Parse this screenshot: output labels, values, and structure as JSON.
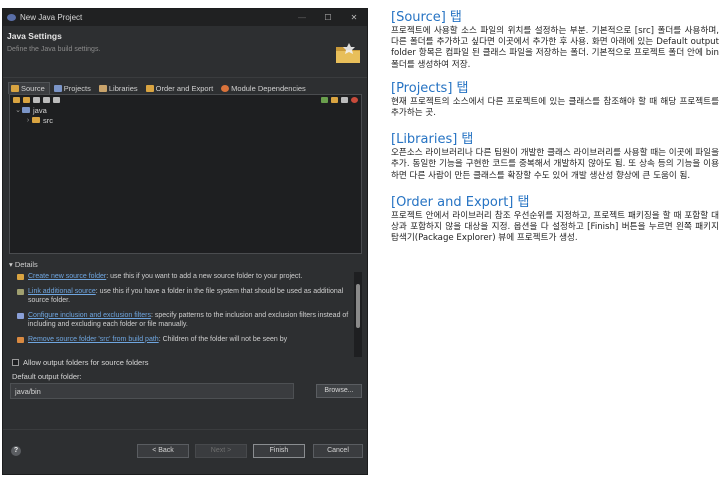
{
  "window": {
    "title": "New Java Project",
    "controls": [
      "—",
      "☐",
      "✕"
    ]
  },
  "banner": {
    "heading": "Java Settings",
    "subtitle": "Define the Java build settings."
  },
  "tabs": [
    {
      "label": "Source",
      "active": true,
      "icon": "source-folder-icon",
      "color": "#d9a441"
    },
    {
      "label": "Projects",
      "active": false,
      "icon": "projects-icon",
      "color": "#7b95c8"
    },
    {
      "label": "Libraries",
      "active": false,
      "icon": "libraries-icon",
      "color": "#c9a36b"
    },
    {
      "label": "Order and Export",
      "active": false,
      "icon": "order-export-icon",
      "color": "#d9a441"
    },
    {
      "label": "Module Dependencies",
      "active": false,
      "icon": "module-dependencies-icon",
      "color": "#d9733b"
    }
  ],
  "tree": {
    "rows": [
      {
        "expander": "⌄",
        "icon": "java-project-icon",
        "label": "java",
        "depth": 0
      },
      {
        "expander": "›",
        "icon": "src-folder-icon",
        "label": "src",
        "depth": 1
      }
    ]
  },
  "details": {
    "heading": "▾ Details",
    "items": [
      {
        "link": "Create new source folder",
        "text": ": use this if you want to add a new source folder to your project.",
        "icon": "new-source-folder-icon"
      },
      {
        "link": "Link additional source",
        "text": ": use this if you have a folder in the file system that should be used as additional source folder.",
        "icon": "link-source-icon"
      },
      {
        "link": "Configure inclusion and exclusion filters",
        "text": ": specify patterns to the inclusion and exclusion filters instead of including and excluding each folder or file manually.",
        "icon": "filter-icon"
      },
      {
        "link": "Remove source folder 'src' from build path",
        "text": ": Children of the folder will not be seen by",
        "icon": "remove-source-icon"
      }
    ]
  },
  "options": {
    "allow_output": "Allow output folders for source folders",
    "allow_output_checked": false,
    "output_label": "Default output folder:",
    "output_value": "java/bin",
    "browse_label": "Browse..."
  },
  "footer": {
    "help": "?",
    "back": "< Back",
    "next": "Next >",
    "finish": "Finish",
    "cancel": "Cancel"
  },
  "notes": [
    {
      "heading": "[Source] 탭",
      "body": "프로젝트에 사용할 소스 파일의 위치를 설정하는 부분. 기본적으로 [src] 폴더를 사용하며, 다른 폴더를 추가하고 싶다면 이곳에서 추가한 후 사용. 화면 아래에 있는 Default output folder 항목은 컴파일 된 클래스 파일을 저장하는 폴더. 기본적으로 프로젝트 폴더 안에 bin 폴더를 생성하여 저장."
    },
    {
      "heading": "[Projects] 탭",
      "body": "현재 프로젝트의 소스에서 다른 프로젝트에 있는 클래스를 참조해야 할 때 해당 프로젝트를 추가하는 곳."
    },
    {
      "heading": "[Libraries] 탭",
      "body": "오픈소스 라이브러리나 다른 팀원이 개발한 클래스 라이브러리를 사용할 때는 이곳에 파일을 추가. 동일한 기능을 구현한 코드를 중복해서 개발하지 않아도 됨. 또 상속 등의 기능을 이용하면 다른 사람이 만든 클래스를 확장할 수도 있어 개발 생산성 향상에 큰 도움이 됨."
    },
    {
      "heading": "[Order and Export] 탭",
      "body": "프로젝트 안에서 라이브러리 참조 우선순위를 지정하고, 프로젝트 패키징을 할 때 포함할 대상과 포함하지 않을 대상을 지정. 옵션을 다 설정하고 [Finish] 버튼을 누르면 왼쪽 패키지 탐색기(Package Explorer) 뷰에 프로젝트가 생성."
    }
  ],
  "colors": {
    "note_heading": "#2673c3",
    "dialog_bg": "#2d2f31",
    "link": "#6fa6e0"
  }
}
